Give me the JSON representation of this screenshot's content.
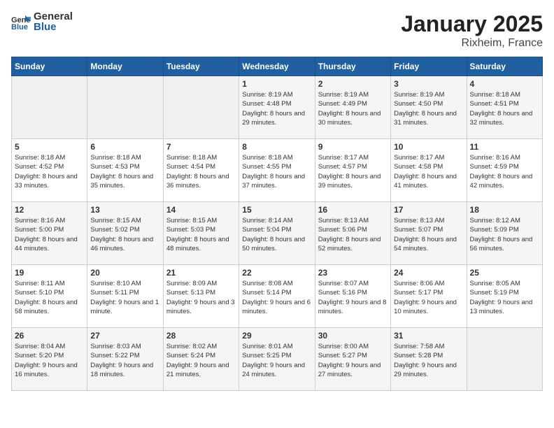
{
  "header": {
    "logo_general": "General",
    "logo_blue": "Blue",
    "month": "January 2025",
    "location": "Rixheim, France"
  },
  "weekdays": [
    "Sunday",
    "Monday",
    "Tuesday",
    "Wednesday",
    "Thursday",
    "Friday",
    "Saturday"
  ],
  "weeks": [
    [
      {
        "day": null
      },
      {
        "day": null
      },
      {
        "day": null
      },
      {
        "day": "1",
        "sunrise": "8:19 AM",
        "sunset": "4:48 PM",
        "daylight": "8 hours and 29 minutes."
      },
      {
        "day": "2",
        "sunrise": "8:19 AM",
        "sunset": "4:49 PM",
        "daylight": "8 hours and 30 minutes."
      },
      {
        "day": "3",
        "sunrise": "8:19 AM",
        "sunset": "4:50 PM",
        "daylight": "8 hours and 31 minutes."
      },
      {
        "day": "4",
        "sunrise": "8:18 AM",
        "sunset": "4:51 PM",
        "daylight": "8 hours and 32 minutes."
      }
    ],
    [
      {
        "day": "5",
        "sunrise": "8:18 AM",
        "sunset": "4:52 PM",
        "daylight": "8 hours and 33 minutes."
      },
      {
        "day": "6",
        "sunrise": "8:18 AM",
        "sunset": "4:53 PM",
        "daylight": "8 hours and 35 minutes."
      },
      {
        "day": "7",
        "sunrise": "8:18 AM",
        "sunset": "4:54 PM",
        "daylight": "8 hours and 36 minutes."
      },
      {
        "day": "8",
        "sunrise": "8:18 AM",
        "sunset": "4:55 PM",
        "daylight": "8 hours and 37 minutes."
      },
      {
        "day": "9",
        "sunrise": "8:17 AM",
        "sunset": "4:57 PM",
        "daylight": "8 hours and 39 minutes."
      },
      {
        "day": "10",
        "sunrise": "8:17 AM",
        "sunset": "4:58 PM",
        "daylight": "8 hours and 41 minutes."
      },
      {
        "day": "11",
        "sunrise": "8:16 AM",
        "sunset": "4:59 PM",
        "daylight": "8 hours and 42 minutes."
      }
    ],
    [
      {
        "day": "12",
        "sunrise": "8:16 AM",
        "sunset": "5:00 PM",
        "daylight": "8 hours and 44 minutes."
      },
      {
        "day": "13",
        "sunrise": "8:15 AM",
        "sunset": "5:02 PM",
        "daylight": "8 hours and 46 minutes."
      },
      {
        "day": "14",
        "sunrise": "8:15 AM",
        "sunset": "5:03 PM",
        "daylight": "8 hours and 48 minutes."
      },
      {
        "day": "15",
        "sunrise": "8:14 AM",
        "sunset": "5:04 PM",
        "daylight": "8 hours and 50 minutes."
      },
      {
        "day": "16",
        "sunrise": "8:13 AM",
        "sunset": "5:06 PM",
        "daylight": "8 hours and 52 minutes."
      },
      {
        "day": "17",
        "sunrise": "8:13 AM",
        "sunset": "5:07 PM",
        "daylight": "8 hours and 54 minutes."
      },
      {
        "day": "18",
        "sunrise": "8:12 AM",
        "sunset": "5:09 PM",
        "daylight": "8 hours and 56 minutes."
      }
    ],
    [
      {
        "day": "19",
        "sunrise": "8:11 AM",
        "sunset": "5:10 PM",
        "daylight": "8 hours and 58 minutes."
      },
      {
        "day": "20",
        "sunrise": "8:10 AM",
        "sunset": "5:11 PM",
        "daylight": "9 hours and 1 minute."
      },
      {
        "day": "21",
        "sunrise": "8:09 AM",
        "sunset": "5:13 PM",
        "daylight": "9 hours and 3 minutes."
      },
      {
        "day": "22",
        "sunrise": "8:08 AM",
        "sunset": "5:14 PM",
        "daylight": "9 hours and 6 minutes."
      },
      {
        "day": "23",
        "sunrise": "8:07 AM",
        "sunset": "5:16 PM",
        "daylight": "9 hours and 8 minutes."
      },
      {
        "day": "24",
        "sunrise": "8:06 AM",
        "sunset": "5:17 PM",
        "daylight": "9 hours and 10 minutes."
      },
      {
        "day": "25",
        "sunrise": "8:05 AM",
        "sunset": "5:19 PM",
        "daylight": "9 hours and 13 minutes."
      }
    ],
    [
      {
        "day": "26",
        "sunrise": "8:04 AM",
        "sunset": "5:20 PM",
        "daylight": "9 hours and 16 minutes."
      },
      {
        "day": "27",
        "sunrise": "8:03 AM",
        "sunset": "5:22 PM",
        "daylight": "9 hours and 18 minutes."
      },
      {
        "day": "28",
        "sunrise": "8:02 AM",
        "sunset": "5:24 PM",
        "daylight": "9 hours and 21 minutes."
      },
      {
        "day": "29",
        "sunrise": "8:01 AM",
        "sunset": "5:25 PM",
        "daylight": "9 hours and 24 minutes."
      },
      {
        "day": "30",
        "sunrise": "8:00 AM",
        "sunset": "5:27 PM",
        "daylight": "9 hours and 27 minutes."
      },
      {
        "day": "31",
        "sunrise": "7:58 AM",
        "sunset": "5:28 PM",
        "daylight": "9 hours and 29 minutes."
      },
      {
        "day": null
      }
    ]
  ],
  "labels": {
    "sunrise_prefix": "Sunrise: ",
    "sunset_prefix": "Sunset: ",
    "daylight_prefix": "Daylight: "
  }
}
